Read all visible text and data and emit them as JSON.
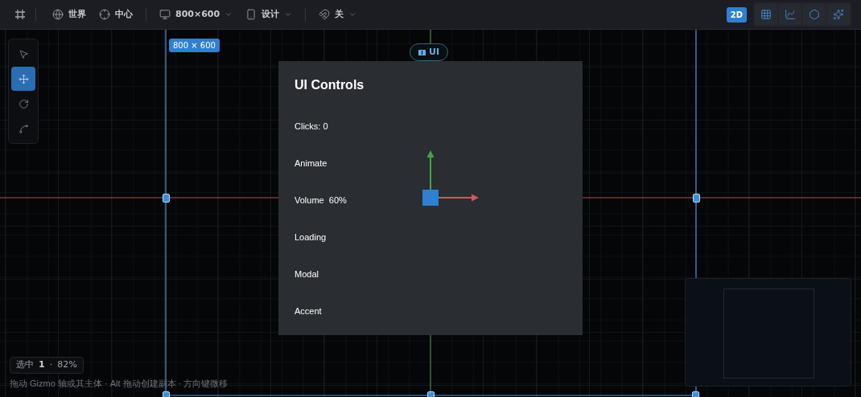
{
  "toolbar": {
    "items": [
      {
        "kind": "globe",
        "label": "世界"
      },
      {
        "kind": "target",
        "label": "中心"
      },
      {
        "kind": "monitor",
        "label": "800×600",
        "dropdown": true
      },
      {
        "kind": "phone",
        "label": "设计",
        "dropdown": true
      },
      {
        "kind": "magnet",
        "label": "关",
        "dropdown": true
      }
    ],
    "mode_badge": "2D",
    "view_buttons": [
      {
        "selected": false
      },
      {
        "selected": false
      },
      {
        "selected": false
      },
      {
        "selected": false
      }
    ]
  },
  "tools": [
    {
      "selected": false
    },
    {
      "selected": true
    },
    {
      "selected": false
    },
    {
      "selected": false
    }
  ],
  "canvas": {
    "frame_label": "800 × 600",
    "layer_tag": "UI",
    "panel": {
      "title": "UI Controls",
      "items": [
        "Clicks: 0",
        "Animate",
        "Volume  60%",
        "Loading",
        "Modal",
        "Accent"
      ]
    }
  },
  "status": {
    "label": "选中",
    "count": "1",
    "separator": "·",
    "zoom": "82%"
  },
  "hint": "拖动 Gizmo 轴或其主体 · Alt 拖动创建副本 · 方向键微移"
}
